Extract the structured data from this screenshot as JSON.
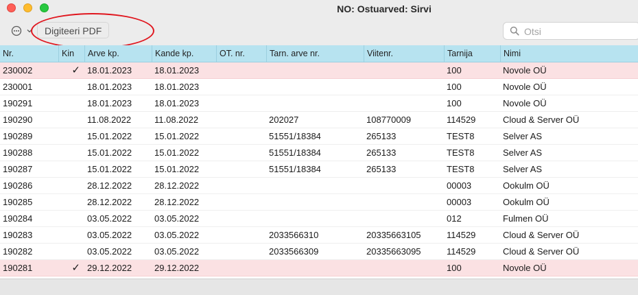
{
  "window": {
    "title": "NO: Ostuarved: Sirvi"
  },
  "toolbar": {
    "digitize_label": "Digiteeri PDF"
  },
  "search": {
    "placeholder": "Otsi"
  },
  "columns": {
    "nr": "Nr.",
    "kin": "Kin",
    "arve_kp": "Arve kp.",
    "kande_kp": "Kande kp.",
    "ot_nr": "OT. nr.",
    "tarn_arve_nr": "Tarn. arve nr.",
    "viitenr": "Viitenr.",
    "tarnija": "Tarnija",
    "nimi": "Nimi"
  },
  "rows": [
    {
      "nr": "230002",
      "kin": "✓",
      "arve_kp": "18.01.2023",
      "kande_kp": "18.01.2023",
      "ot_nr": "",
      "tarn_arve_nr": "",
      "viitenr": "",
      "tarnija": "100",
      "nimi": "Novole OÜ"
    },
    {
      "nr": "230001",
      "kin": "",
      "arve_kp": "18.01.2023",
      "kande_kp": "18.01.2023",
      "ot_nr": "",
      "tarn_arve_nr": "",
      "viitenr": "",
      "tarnija": "100",
      "nimi": "Novole OÜ"
    },
    {
      "nr": "190291",
      "kin": "",
      "arve_kp": "18.01.2023",
      "kande_kp": "18.01.2023",
      "ot_nr": "",
      "tarn_arve_nr": "",
      "viitenr": "",
      "tarnija": "100",
      "nimi": "Novole OÜ"
    },
    {
      "nr": "190290",
      "kin": "",
      "arve_kp": "11.08.2022",
      "kande_kp": "11.08.2022",
      "ot_nr": "",
      "tarn_arve_nr": "202027",
      "viitenr": "108770009",
      "tarnija": "114529",
      "nimi": "Cloud & Server OÜ"
    },
    {
      "nr": "190289",
      "kin": "",
      "arve_kp": "15.01.2022",
      "kande_kp": "15.01.2022",
      "ot_nr": "",
      "tarn_arve_nr": "51551/18384",
      "viitenr": "265133",
      "tarnija": "TEST8",
      "nimi": "Selver AS"
    },
    {
      "nr": "190288",
      "kin": "",
      "arve_kp": "15.01.2022",
      "kande_kp": "15.01.2022",
      "ot_nr": "",
      "tarn_arve_nr": "51551/18384",
      "viitenr": "265133",
      "tarnija": "TEST8",
      "nimi": "Selver AS"
    },
    {
      "nr": "190287",
      "kin": "",
      "arve_kp": "15.01.2022",
      "kande_kp": "15.01.2022",
      "ot_nr": "",
      "tarn_arve_nr": "51551/18384",
      "viitenr": "265133",
      "tarnija": "TEST8",
      "nimi": "Selver AS"
    },
    {
      "nr": "190286",
      "kin": "",
      "arve_kp": "28.12.2022",
      "kande_kp": "28.12.2022",
      "ot_nr": "",
      "tarn_arve_nr": "",
      "viitenr": "",
      "tarnija": "00003",
      "nimi": "Ookulm OÜ"
    },
    {
      "nr": "190285",
      "kin": "",
      "arve_kp": "28.12.2022",
      "kande_kp": "28.12.2022",
      "ot_nr": "",
      "tarn_arve_nr": "",
      "viitenr": "",
      "tarnija": "00003",
      "nimi": "Ookulm OÜ"
    },
    {
      "nr": "190284",
      "kin": "",
      "arve_kp": "03.05.2022",
      "kande_kp": "03.05.2022",
      "ot_nr": "",
      "tarn_arve_nr": "",
      "viitenr": "",
      "tarnija": "012",
      "nimi": "Fulmen OÜ"
    },
    {
      "nr": "190283",
      "kin": "",
      "arve_kp": "03.05.2022",
      "kande_kp": "03.05.2022",
      "ot_nr": "",
      "tarn_arve_nr": "2033566310",
      "viitenr": "20335663105",
      "tarnija": "114529",
      "nimi": "Cloud & Server OÜ"
    },
    {
      "nr": "190282",
      "kin": "",
      "arve_kp": "03.05.2022",
      "kande_kp": "03.05.2022",
      "ot_nr": "",
      "tarn_arve_nr": "2033566309",
      "viitenr": "20335663095",
      "tarnija": "114529",
      "nimi": "Cloud & Server OÜ"
    },
    {
      "nr": "190281",
      "kin": "✓",
      "arve_kp": "29.12.2022",
      "kande_kp": "29.12.2022",
      "ot_nr": "",
      "tarn_arve_nr": "",
      "viitenr": "",
      "tarnija": "100",
      "nimi": "Novole OÜ"
    }
  ],
  "icons": {
    "more": "ellipsis-circle-icon",
    "search": "magnifier-icon",
    "checkmark": "checkmark-icon"
  },
  "colors": {
    "header_bg": "#b7e3f0",
    "highlight_row_bg": "#fbe1e3",
    "annotation_ellipse": "#e0161e"
  }
}
